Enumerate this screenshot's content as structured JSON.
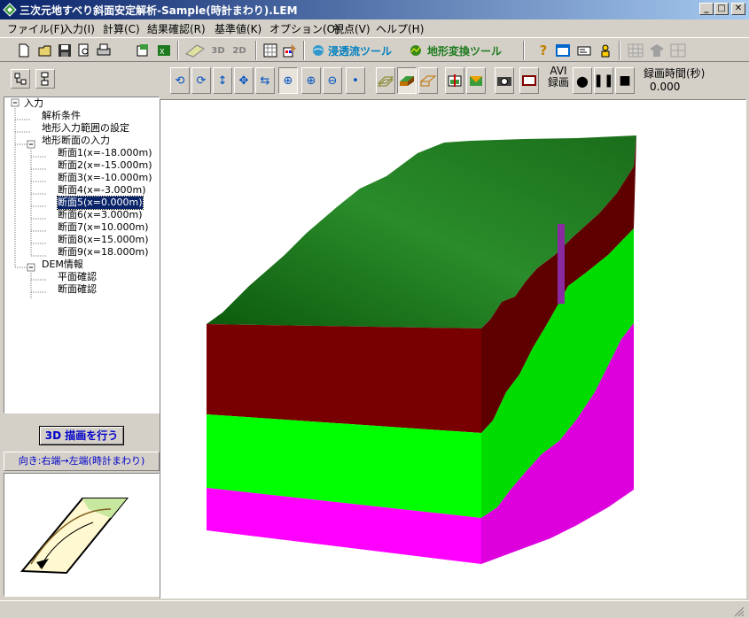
{
  "window": {
    "title": "三次元地すべり斜面安定解析-Sample(時計まわり).LEM",
    "minimize_glyph": "_",
    "maximize_glyph": "□",
    "close_glyph": "✕"
  },
  "menu": [
    "ファイル(F)",
    "入力(I)",
    "計算(C)",
    "結果確認(R)",
    "基準値(K)",
    "オプション(O)",
    "視点(V)",
    "ヘルプ(H)"
  ],
  "toolbar": {
    "seepage_tool": "浸透流ツール",
    "terrain_tool": "地形変換ツール",
    "btn_3d": "3D",
    "btn_2d": "2D"
  },
  "tree": {
    "root": "入力",
    "analysis_conditions": "解析条件",
    "terrain_range": "地形入力範囲の設定",
    "sections_group": "地形断面の入力",
    "sections": [
      "断面1(x=-18.000m)",
      "断面2(x=-15.000m)",
      "断面3(x=-10.000m)",
      "断面4(x=-3.000m)",
      "断面5(x=0.000m)",
      "断面6(x=3.000m)",
      "断面7(x=10.000m)",
      "断面8(x=15.000m)",
      "断面9(x=18.000m)"
    ],
    "selected_index": 4,
    "dem_group": "DEM情報",
    "dem_items": [
      "平面確認",
      "断面確認"
    ]
  },
  "left_panel": {
    "draw_button": "3D 描画を行う",
    "direction_label": "向き:右端→左端(時計まわり)"
  },
  "view_toolbar": {
    "avi_label": "AVI",
    "record_label": "録画",
    "time_label": "録画時間(秒)",
    "time_value": "0.000"
  },
  "colors": {
    "ground_top": "#1e7a1e",
    "layer_red": "#780000",
    "layer_green": "#00ff00",
    "layer_magenta": "#ff00ff",
    "accent": "#0a246a"
  }
}
